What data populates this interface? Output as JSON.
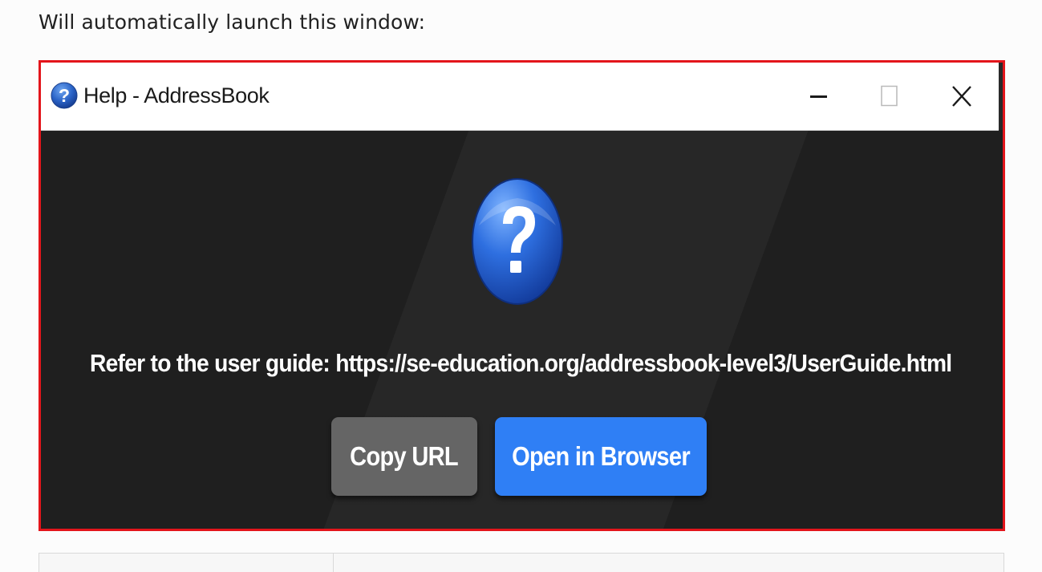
{
  "intro": {
    "text": "Will automatically launch this window:"
  },
  "window": {
    "title": "Help - AddressBook",
    "controls": {
      "minimize_icon": "minimize-icon",
      "maximize_icon": "maximize-icon",
      "close_icon": "close-icon"
    },
    "title_icon": "help-icon"
  },
  "dialog": {
    "icon": "help-icon",
    "message": "Refer to the user guide: https://se-education.org/addressbook-level3/UserGuide.html",
    "buttons": {
      "copy_url": "Copy URL",
      "open_in_browser": "Open in Browser"
    }
  },
  "colors": {
    "frame_border": "#e3151b",
    "dialog_background": "#1f1f1f",
    "copy_button": "#656565",
    "open_button": "#2f7ff5"
  }
}
